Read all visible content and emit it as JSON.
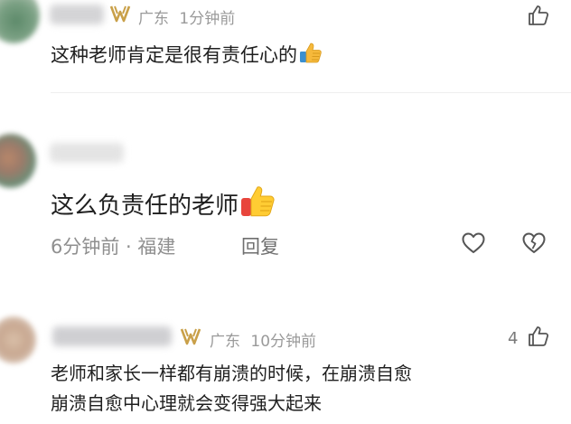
{
  "comments": [
    {
      "location": "广东",
      "time": "1分钟前",
      "text": "这种老师肯定是很有责任心的"
    },
    {
      "text": "这么负责任的老师",
      "footer": "6分钟前 · 福建",
      "reply_label": "回复"
    },
    {
      "location": "广东",
      "time": "10分钟前",
      "like_count": "4",
      "text_line1": "老师和家长一样都有崩溃的时候，在崩溃自愈",
      "text_line2": "崩溃自愈中心理就会变得强大起来"
    }
  ],
  "colors": {
    "vip_gold": "#c9a049",
    "meta_gray": "#9a9a9a",
    "text": "#1f1f1f"
  },
  "icons": [
    "vip-badge-icon",
    "thumbs-up-icon",
    "heart-icon",
    "broken-heart-icon",
    "thumbs-up-emoji-icon"
  ]
}
